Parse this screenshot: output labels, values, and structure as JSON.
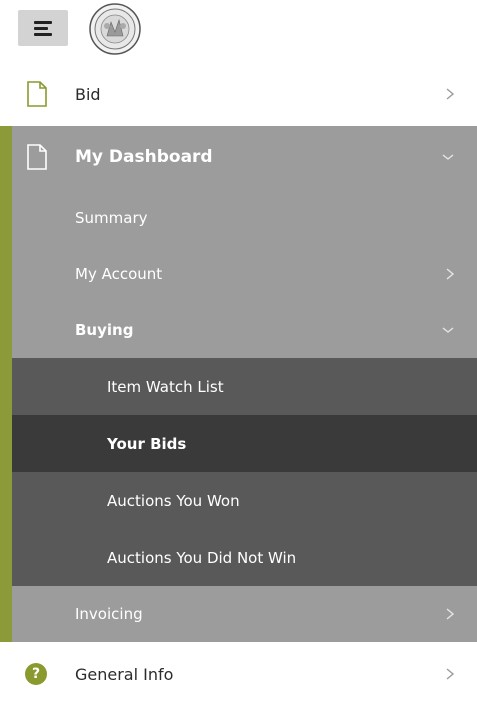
{
  "header": {
    "menu_icon": "hamburger-icon",
    "seal_icon": "state-seal-icon"
  },
  "nav": {
    "bid": {
      "label": "Bid",
      "icon": "document-icon",
      "chevron": "chevron-right-icon"
    },
    "dashboard": {
      "label": "My Dashboard",
      "icon": "document-icon",
      "chevron": "chevron-down-icon",
      "expanded": true,
      "items": {
        "summary": {
          "label": "Summary"
        },
        "account": {
          "label": "My Account",
          "chevron": "chevron-right-icon"
        },
        "buying": {
          "label": "Buying",
          "chevron": "chevron-down-icon",
          "expanded": true,
          "items": [
            {
              "label": "Item Watch List",
              "selected": false
            },
            {
              "label": "Your Bids",
              "selected": true
            },
            {
              "label": "Auctions You Won",
              "selected": false
            },
            {
              "label": "Auctions You Did Not Win",
              "selected": false
            }
          ]
        },
        "invoicing": {
          "label": "Invoicing",
          "chevron": "chevron-right-icon"
        }
      }
    },
    "general_info": {
      "label": "General Info",
      "icon": "question-icon",
      "icon_glyph": "?",
      "chevron": "chevron-right-icon"
    }
  },
  "colors": {
    "accent": "#8c9a3a",
    "dashboard_bg": "#9c9c9c",
    "sub_bg": "#595959",
    "selected_bg": "#3a3a3a"
  }
}
